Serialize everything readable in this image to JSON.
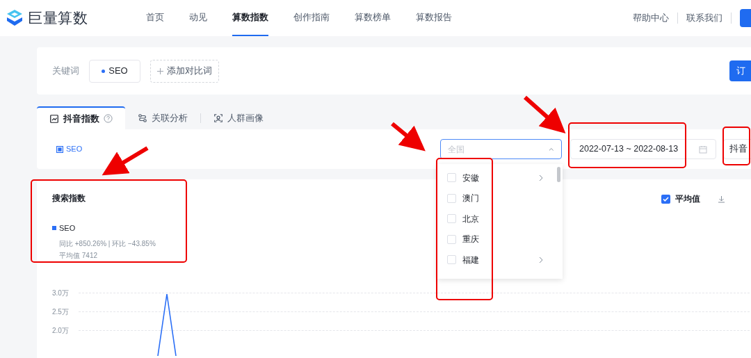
{
  "header": {
    "brand": "巨量算数",
    "nav": [
      {
        "label": "首页",
        "selected": false
      },
      {
        "label": "动见",
        "selected": false
      },
      {
        "label": "算数指数",
        "selected": true
      },
      {
        "label": "创作指南",
        "selected": false
      },
      {
        "label": "算数榜单",
        "selected": false
      },
      {
        "label": "算数报告",
        "selected": false
      }
    ],
    "links": [
      "帮助中心",
      "联系我们"
    ]
  },
  "keywords": {
    "label": "关键词",
    "terms": [
      {
        "text": "SEO",
        "color": "#2b6ff6"
      }
    ],
    "add_button": "添加对比词",
    "subscribe_button": "订"
  },
  "tabs": [
    {
      "label": "抖音指数",
      "selected": true,
      "kind": "chart",
      "help": true
    },
    {
      "label": "关联分析",
      "selected": false,
      "kind": "link",
      "help": false
    },
    {
      "label": "人群画像",
      "selected": false,
      "kind": "person",
      "help": false
    }
  ],
  "filters": {
    "legend": "SEO",
    "region": {
      "placeholder": "全国",
      "expanded": true
    },
    "date_range": "2022-07-13 ~ 2022-08-13",
    "platform": "抖音"
  },
  "region_menu": [
    {
      "label": "安徽",
      "checked": false,
      "has_children": true
    },
    {
      "label": "澳门",
      "checked": false,
      "has_children": false
    },
    {
      "label": "北京",
      "checked": false,
      "has_children": false
    },
    {
      "label": "重庆",
      "checked": false,
      "has_children": false
    },
    {
      "label": "福建",
      "checked": false,
      "has_children": true
    }
  ],
  "chart_panel": {
    "title": "搜索指数",
    "series": {
      "name": "SEO",
      "color": "#2b6ff6"
    },
    "comparison": "同比 +850.26% | 环比 −43.85%",
    "average": "平均值 7412",
    "average_toggle": {
      "label": "平均值",
      "checked": true
    },
    "y_axis_labels": [
      "3.0万",
      "2.5万",
      "2.0万"
    ]
  }
}
